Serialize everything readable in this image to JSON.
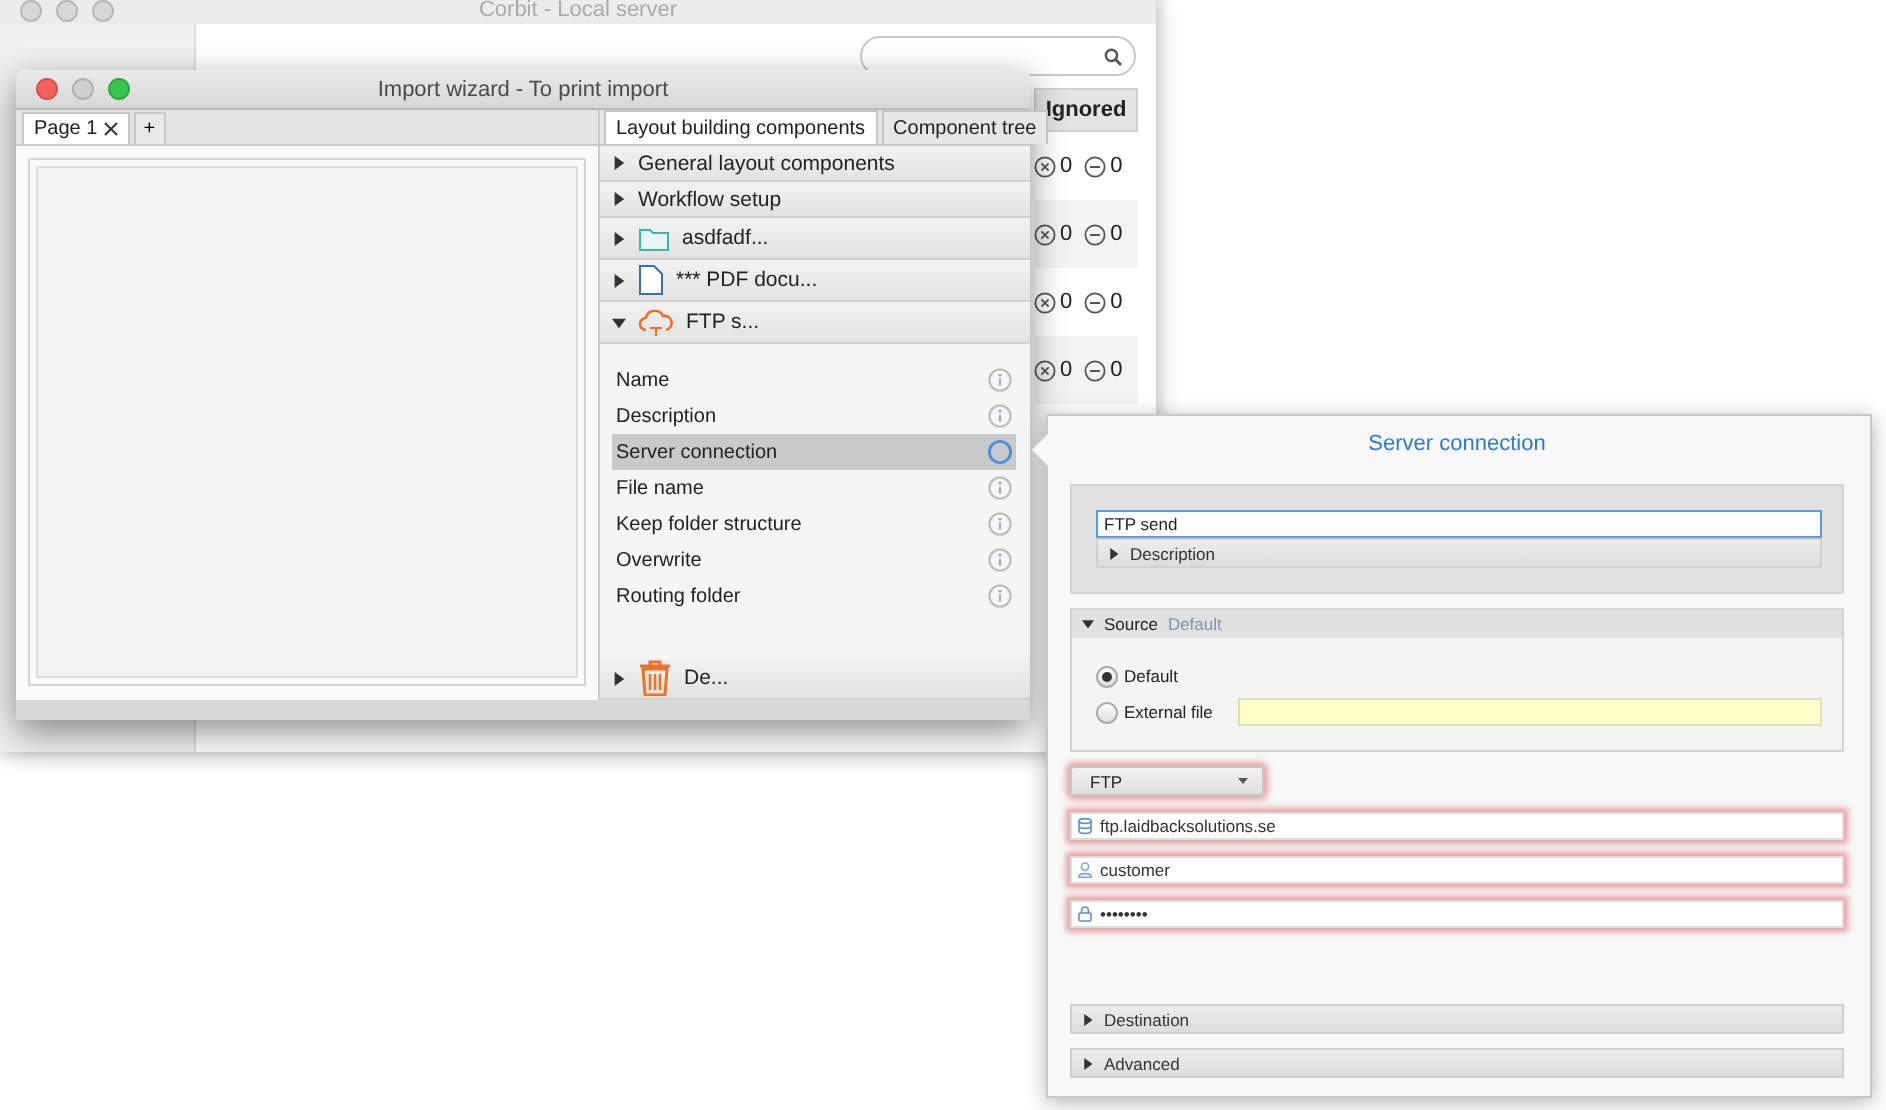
{
  "background_window": {
    "title": "Corbit - Local server",
    "header_button": "Ignored",
    "rows": [
      {
        "failed": "0",
        "ignored": "0"
      },
      {
        "failed": "0",
        "ignored": "0"
      },
      {
        "failed": "0",
        "ignored": "0"
      },
      {
        "failed": "0",
        "ignored": "0"
      }
    ]
  },
  "wizard": {
    "title": "Import wizard - To print import",
    "page_tabs": [
      {
        "label": "Page 1",
        "selected": true
      }
    ],
    "add_tab": "+",
    "panel_tabs": [
      {
        "label": "Layout building components",
        "selected": true
      },
      {
        "label": "Component tree",
        "selected": false
      }
    ],
    "sections": [
      {
        "kind": "plain",
        "label": "General layout components",
        "expanded": false
      },
      {
        "kind": "plain",
        "label": "Workflow setup",
        "expanded": false
      },
      {
        "kind": "folder",
        "label": "asdfadf...",
        "expanded": false
      },
      {
        "kind": "document",
        "label": "*** PDF docu...",
        "expanded": false
      },
      {
        "kind": "ftp",
        "label": "FTP s...",
        "expanded": true,
        "properties": [
          {
            "label": "Name",
            "selected": false
          },
          {
            "label": "Description",
            "selected": false
          },
          {
            "label": "Server connection",
            "selected": true
          },
          {
            "label": "File name",
            "selected": false
          },
          {
            "label": "Keep folder structure",
            "selected": false
          },
          {
            "label": "Overwrite",
            "selected": false
          },
          {
            "label": "Routing folder",
            "selected": false
          }
        ]
      },
      {
        "kind": "trash",
        "label": "De...",
        "expanded": false
      }
    ]
  },
  "popover": {
    "title": "Server connection",
    "name_field": {
      "value": "FTP send"
    },
    "description": {
      "label": "Description",
      "expanded": false
    },
    "source": {
      "label": "Source",
      "value": "Default",
      "expanded": true,
      "options": [
        {
          "label": "Default",
          "selected": true
        },
        {
          "label": "External file",
          "selected": false
        }
      ]
    },
    "protocol": {
      "value": "FTP",
      "invalid": true
    },
    "fields": [
      {
        "kind": "host",
        "value": "ftp.laidbacksolutions.se",
        "invalid": true
      },
      {
        "kind": "user",
        "value": "customer",
        "invalid": true
      },
      {
        "kind": "password",
        "value": "••••••••",
        "invalid": true
      }
    ],
    "sections": [
      {
        "label": "Destination",
        "expanded": false
      },
      {
        "label": "Advanced",
        "expanded": false
      }
    ]
  }
}
